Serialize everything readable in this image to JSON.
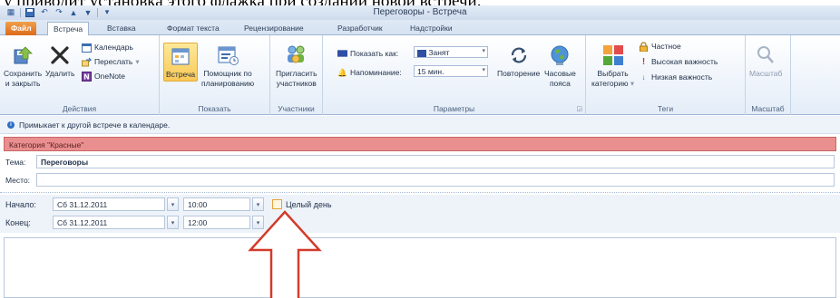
{
  "document": {
    "caption": "у приводит установка этого флажка при создании новой встречи."
  },
  "window": {
    "title": "Переговоры - Встреча"
  },
  "tabs": [
    {
      "label": "Файл"
    },
    {
      "label": "Встреча"
    },
    {
      "label": "Вставка"
    },
    {
      "label": "Формат текста"
    },
    {
      "label": "Рецензирование"
    },
    {
      "label": "Разработчик"
    },
    {
      "label": "Надстройки"
    }
  ],
  "ribbon": {
    "actions": {
      "label": "Действия",
      "save_close": [
        "Сохранить",
        "и закрыть"
      ],
      "delete": "Удалить",
      "calendar": "Календарь",
      "forward": "Переслать",
      "onenote": "OneNote"
    },
    "show": {
      "label": "Показать",
      "appointment": "Встреча",
      "scheduling": [
        "Помощник по",
        "планированию"
      ]
    },
    "attendees": {
      "label": "Участники",
      "invite": [
        "Пригласить",
        "участников"
      ]
    },
    "options": {
      "label": "Параметры",
      "show_as_label": "Показать как:",
      "show_as_value": "Занят",
      "reminder_label": "Напоминание:",
      "reminder_value": "15 мин.",
      "recurrence": "Повторение",
      "time_zones": [
        "Часовые",
        "пояса"
      ]
    },
    "tags": {
      "label": "Теги",
      "categorize": [
        "Выбрать",
        "категорию"
      ],
      "private": "Частное",
      "high_importance": "Высокая важность",
      "low_importance": "Низкая важность"
    },
    "zoom": {
      "label": "Масштаб",
      "button": "Масштаб"
    }
  },
  "infobar": {
    "text": "Примыкает к другой встрече в календаре."
  },
  "category": {
    "text": "Категория \"Красные\""
  },
  "form": {
    "subject_label": "Тема:",
    "subject_value": "Переговоры",
    "location_label": "Место:",
    "location_value": "",
    "start_label": "Начало:",
    "start_date": "Сб 31.12.2011",
    "start_time": "10:00",
    "end_label": "Конец:",
    "end_date": "Сб 31.12.2011",
    "end_time": "12:00",
    "all_day_label": "Целый день",
    "all_day_checked": false
  },
  "colors": {
    "accent": "#2b5797",
    "file_tab": "#dc6a1a",
    "category": "#e98f8f",
    "highlight": "#f9c855",
    "arrow": "#d23b2b"
  }
}
